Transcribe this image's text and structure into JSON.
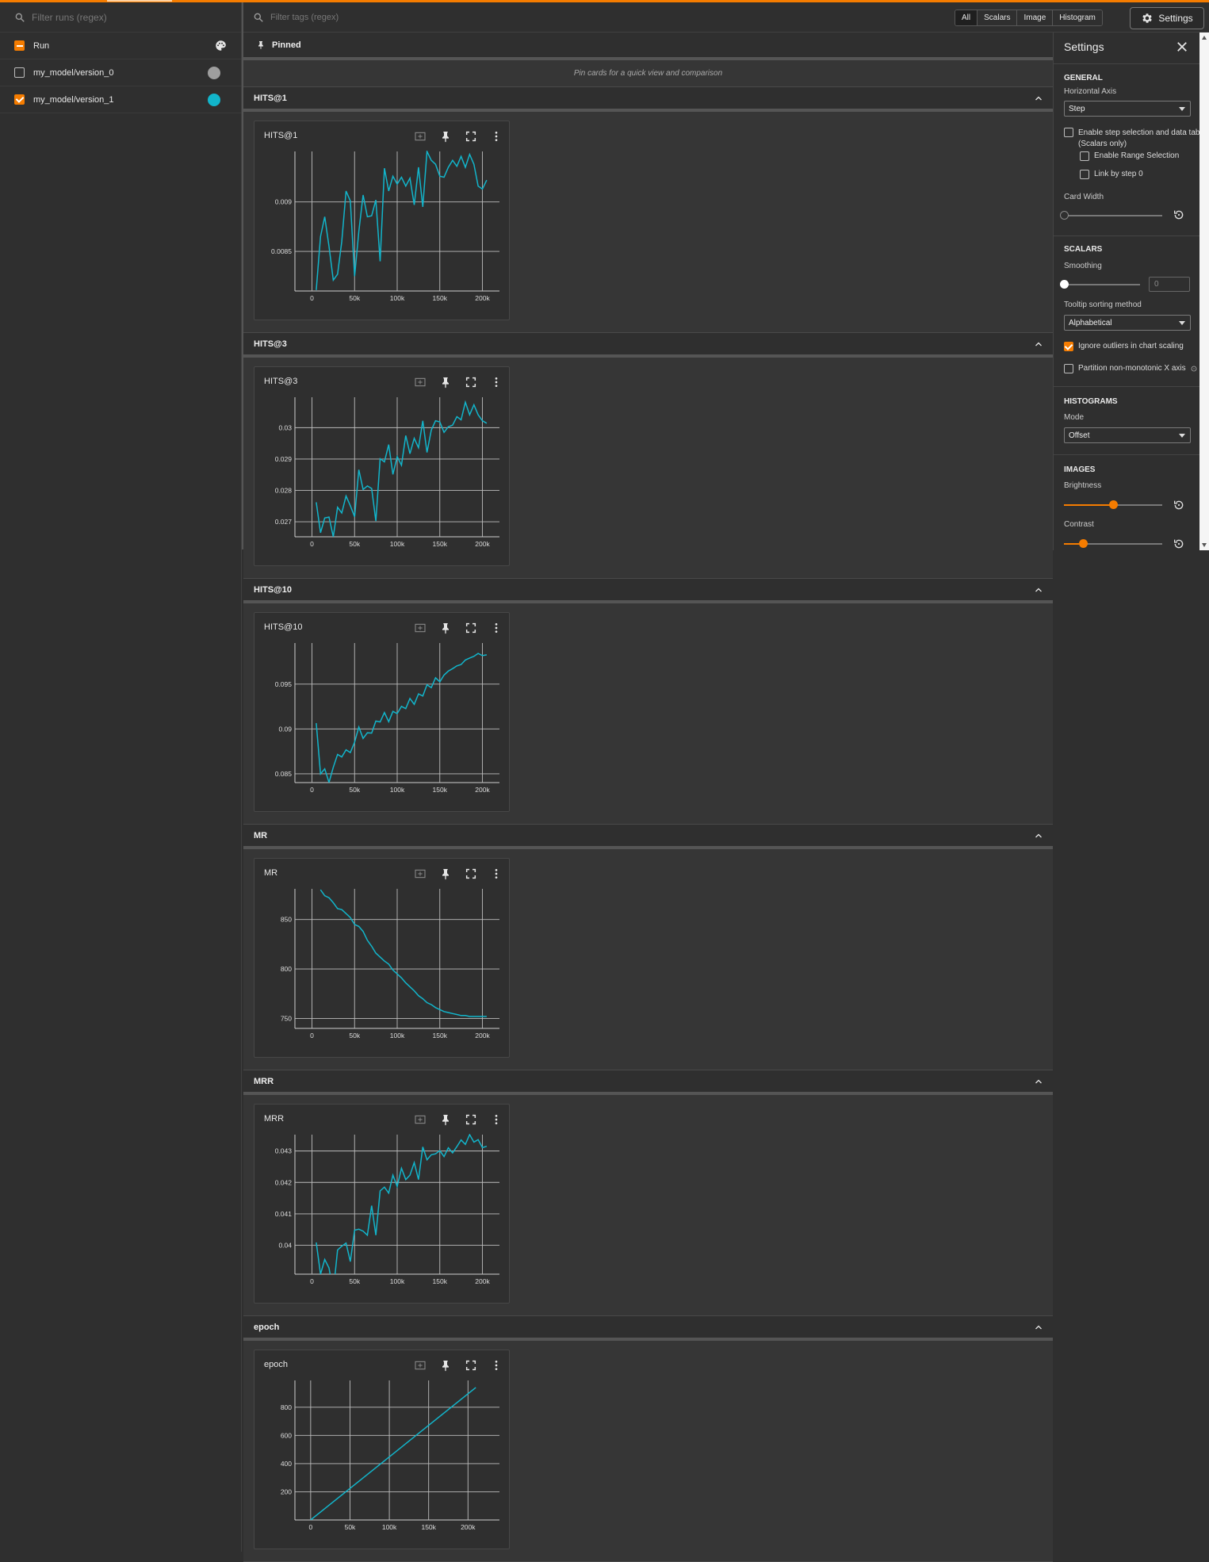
{
  "runs_panel": {
    "search_placeholder": "Filter runs (regex)",
    "header_label": "Run",
    "runs": [
      {
        "label": "my_model/version_0",
        "checked": false,
        "color": "#9e9e9e"
      },
      {
        "label": "my_model/version_1",
        "checked": true,
        "color": "#12b5cb"
      }
    ]
  },
  "tags_header": {
    "search_placeholder": "Filter tags (regex)",
    "chips": [
      "All",
      "Scalars",
      "Image",
      "Histogram"
    ],
    "active_chip": "All",
    "settings_label": "Settings"
  },
  "pinned": {
    "label": "Pinned",
    "empty_text": "Pin cards for a quick view and comparison"
  },
  "groups": [
    {
      "name": "HITS@1",
      "card_title": "HITS@1",
      "chart_data": {
        "type": "line",
        "title": "HITS@1",
        "x_ticks": [
          0,
          50000,
          100000,
          150000,
          200000
        ],
        "x_tick_labels": [
          "0",
          "50k",
          "100k",
          "150k",
          "200k"
        ],
        "y_ticks": [
          0.0085,
          0.009
        ],
        "y_tick_labels": [
          "0.0085",
          "0.009"
        ],
        "xlim": [
          -20000,
          220000
        ],
        "ylim": [
          0.0081,
          0.00951
        ],
        "series": [
          {
            "color": "#12b5cb",
            "x": [
              5000,
              10000,
              15000,
              20000,
              25000,
              30000,
              35000,
              40000,
              45000,
              50000,
              55000,
              60000,
              65000,
              70000,
              75000,
              80000,
              85000,
              90000,
              95000,
              100000,
              105000,
              110000,
              115000,
              120000,
              125000,
              130000,
              135000,
              140000,
              145000,
              150000,
              155000,
              160000,
              165000,
              170000,
              175000,
              180000,
              185000,
              190000,
              195000,
              200000,
              205000
            ],
            "y": [
              0.00811,
              0.00865,
              0.00885,
              0.00855,
              0.00821,
              0.00827,
              0.0086,
              0.00911,
              0.00901,
              0.00825,
              0.0087,
              0.00907,
              0.00885,
              0.00886,
              0.00902,
              0.0084,
              0.00934,
              0.00911,
              0.00926,
              0.00918,
              0.00925,
              0.00916,
              0.00924,
              0.00897,
              0.00935,
              0.00895,
              0.00951,
              0.00942,
              0.00938,
              0.00926,
              0.00925,
              0.00935,
              0.00942,
              0.00936,
              0.00946,
              0.00935,
              0.00948,
              0.00938,
              0.00916,
              0.00913,
              0.00922
            ]
          }
        ]
      }
    },
    {
      "name": "HITS@3",
      "card_title": "HITS@3",
      "chart_data": {
        "type": "line",
        "title": "HITS@3",
        "x_ticks": [
          0,
          50000,
          100000,
          150000,
          200000
        ],
        "x_tick_labels": [
          "0",
          "50k",
          "100k",
          "150k",
          "200k"
        ],
        "y_ticks": [
          0.027,
          0.028,
          0.029,
          0.03
        ],
        "y_tick_labels": [
          "0.027",
          "0.028",
          "0.029",
          "0.03"
        ],
        "xlim": [
          -20000,
          220000
        ],
        "ylim": [
          0.02652,
          0.03097
        ],
        "series": [
          {
            "color": "#12b5cb",
            "x": [
              5000,
              10000,
              15000,
              20000,
              25000,
              30000,
              35000,
              40000,
              45000,
              50000,
              55000,
              60000,
              65000,
              70000,
              75000,
              80000,
              85000,
              90000,
              95000,
              100000,
              105000,
              110000,
              115000,
              120000,
              125000,
              130000,
              135000,
              140000,
              145000,
              150000,
              155000,
              160000,
              165000,
              170000,
              175000,
              180000,
              185000,
              190000,
              195000,
              200000,
              205000
            ],
            "y": [
              0.02762,
              0.02665,
              0.02712,
              0.02715,
              0.02652,
              0.02746,
              0.02728,
              0.02782,
              0.02751,
              0.02716,
              0.02866,
              0.02803,
              0.02814,
              0.02806,
              0.02702,
              0.02901,
              0.02891,
              0.02946,
              0.02851,
              0.02908,
              0.0288,
              0.02975,
              0.02917,
              0.02966,
              0.02936,
              0.03022,
              0.02921,
              0.02992,
              0.03022,
              0.03018,
              0.02985,
              0.03003,
              0.03008,
              0.03035,
              0.03025,
              0.03081,
              0.03041,
              0.03073,
              0.03041,
              0.03022,
              0.03014
            ]
          }
        ]
      }
    },
    {
      "name": "HITS@10",
      "card_title": "HITS@10",
      "chart_data": {
        "type": "line",
        "title": "HITS@10",
        "x_ticks": [
          0,
          50000,
          100000,
          150000,
          200000
        ],
        "x_tick_labels": [
          "0",
          "50k",
          "100k",
          "150k",
          "200k"
        ],
        "y_ticks": [
          0.085,
          0.09,
          0.095
        ],
        "y_tick_labels": [
          "0.085",
          "0.09",
          "0.095"
        ],
        "xlim": [
          -20000,
          220000
        ],
        "ylim": [
          0.08402,
          0.09958
        ],
        "series": [
          {
            "color": "#12b5cb",
            "x": [
              5000,
              10000,
              15000,
              20000,
              25000,
              30000,
              35000,
              40000,
              45000,
              50000,
              55000,
              60000,
              65000,
              70000,
              75000,
              80000,
              85000,
              90000,
              95000,
              100000,
              105000,
              110000,
              115000,
              120000,
              125000,
              130000,
              135000,
              140000,
              145000,
              150000,
              155000,
              160000,
              165000,
              170000,
              175000,
              180000,
              185000,
              190000,
              195000,
              200000,
              205000
            ],
            "y": [
              0.09065,
              0.08498,
              0.08555,
              0.08404,
              0.08573,
              0.08716,
              0.08688,
              0.08767,
              0.08737,
              0.08853,
              0.09022,
              0.08894,
              0.08957,
              0.08954,
              0.09088,
              0.09078,
              0.09183,
              0.09081,
              0.09196,
              0.09171,
              0.09252,
              0.09227,
              0.0934,
              0.09275,
              0.09391,
              0.09367,
              0.09493,
              0.0946,
              0.09571,
              0.09526,
              0.09601,
              0.09645,
              0.09672,
              0.09703,
              0.09718,
              0.09769,
              0.09791,
              0.0981,
              0.09842,
              0.09817,
              0.09826
            ]
          }
        ]
      }
    },
    {
      "name": "MR",
      "card_title": "MR",
      "chart_data": {
        "type": "line",
        "title": "MR",
        "x_ticks": [
          0,
          50000,
          100000,
          150000,
          200000
        ],
        "x_tick_labels": [
          "0",
          "50k",
          "100k",
          "150k",
          "200k"
        ],
        "y_ticks": [
          750,
          800,
          850
        ],
        "y_tick_labels": [
          "750",
          "800",
          "850"
        ],
        "xlim": [
          -20000,
          220000
        ],
        "ylim": [
          740,
          881
        ],
        "series": [
          {
            "color": "#12b5cb",
            "x": [
              10000,
              15000,
              20000,
              25000,
              30000,
              35000,
              40000,
              45000,
              50000,
              55000,
              60000,
              65000,
              70000,
              75000,
              80000,
              85000,
              90000,
              95000,
              100000,
              105000,
              110000,
              115000,
              120000,
              125000,
              130000,
              135000,
              140000,
              145000,
              150000,
              155000,
              160000,
              165000,
              170000,
              175000,
              180000,
              185000,
              190000,
              195000,
              200000,
              205000
            ],
            "y": [
              880,
              874,
              872,
              867,
              861,
              860,
              856,
              852,
              845,
              843,
              838,
              829,
              823,
              816,
              812,
              808,
              805,
              799,
              795,
              791,
              786,
              782,
              778,
              773,
              770,
              766,
              764,
              761,
              759,
              757,
              756,
              755,
              754,
              753,
              753,
              752,
              752,
              752,
              752,
              752
            ]
          }
        ]
      }
    },
    {
      "name": "MRR",
      "card_title": "MRR",
      "chart_data": {
        "type": "line",
        "title": "MRR",
        "x_ticks": [
          0,
          50000,
          100000,
          150000,
          200000
        ],
        "x_tick_labels": [
          "0",
          "50k",
          "100k",
          "150k",
          "200k"
        ],
        "y_ticks": [
          0.04,
          0.041,
          0.042,
          0.043
        ],
        "y_tick_labels": [
          "0.04",
          "0.041",
          "0.042",
          "0.043"
        ],
        "xlim": [
          -20000,
          220000
        ],
        "ylim": [
          0.03908,
          0.04352
        ],
        "series": [
          {
            "color": "#12b5cb",
            "x": [
              5000,
              10000,
              15000,
              20000,
              25000,
              30000,
              35000,
              40000,
              45000,
              50000,
              55000,
              60000,
              65000,
              70000,
              75000,
              80000,
              85000,
              90000,
              95000,
              100000,
              105000,
              110000,
              115000,
              120000,
              125000,
              130000,
              135000,
              140000,
              145000,
              150000,
              155000,
              160000,
              165000,
              170000,
              175000,
              180000,
              185000,
              190000,
              195000,
              200000,
              205000
            ],
            "y": [
              0.04009,
              0.03908,
              0.03955,
              0.03928,
              0.03852,
              0.03985,
              0.03997,
              0.04007,
              0.03948,
              0.04048,
              0.04051,
              0.04045,
              0.04032,
              0.04126,
              0.04032,
              0.04173,
              0.04185,
              0.04166,
              0.04223,
              0.04187,
              0.04245,
              0.04209,
              0.04223,
              0.04263,
              0.04209,
              0.04313,
              0.04272,
              0.04288,
              0.04291,
              0.04301,
              0.04282,
              0.0431,
              0.04294,
              0.04314,
              0.04335,
              0.04321,
              0.04352,
              0.04328,
              0.04336,
              0.04311,
              0.04315
            ]
          }
        ]
      }
    },
    {
      "name": "epoch",
      "card_title": "epoch",
      "chart_data": {
        "type": "line",
        "title": "epoch",
        "x_ticks": [
          0,
          50000,
          100000,
          150000,
          200000
        ],
        "x_tick_labels": [
          "0",
          "50k",
          "100k",
          "150k",
          "200k"
        ],
        "y_ticks": [
          200,
          400,
          600,
          800
        ],
        "y_tick_labels": [
          "200",
          "400",
          "600",
          "800"
        ],
        "xlim": [
          -20000,
          240000
        ],
        "ylim": [
          0,
          990
        ],
        "series": [
          {
            "color": "#12b5cb",
            "x": [
              0,
              210000
            ],
            "y": [
              0,
              940
            ]
          }
        ]
      }
    }
  ],
  "settings": {
    "title": "Settings",
    "general": {
      "title": "GENERAL",
      "horizontal_axis_label": "Horizontal Axis",
      "horizontal_axis_value": "Step",
      "enable_step_selection": "Enable step selection and data table",
      "scalars_only": "(Scalars only)",
      "enable_range_selection": "Enable Range Selection",
      "link_by_step": "Link by step 0",
      "card_width_label": "Card Width"
    },
    "scalars": {
      "title": "SCALARS",
      "smoothing_label": "Smoothing",
      "smoothing_value": "0",
      "tooltip_label": "Tooltip sorting method",
      "tooltip_value": "Alphabetical",
      "ignore_outliers": "Ignore outliers in chart scaling",
      "partition": "Partition non-monotonic X axis"
    },
    "histograms": {
      "title": "HISTOGRAMS",
      "mode_label": "Mode",
      "mode_value": "Offset"
    },
    "images": {
      "title": "IMAGES",
      "brightness_label": "Brightness",
      "brightness_value": 0.5,
      "contrast_label": "Contrast",
      "contrast_value": 0.2
    }
  }
}
